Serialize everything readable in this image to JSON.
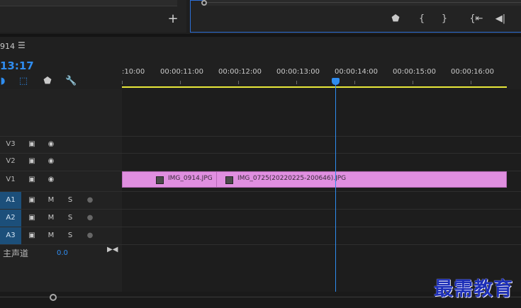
{
  "source_panel": {
    "add_icon": "plus-icon",
    "add_glyph": "+"
  },
  "program_monitor": {
    "buttons": [
      {
        "name": "add-marker-button",
        "glyph": "⬟",
        "icon": "marker-icon"
      },
      {
        "name": "mark-in-button",
        "glyph": "{",
        "icon": "mark-in-icon"
      },
      {
        "name": "mark-out-button",
        "glyph": "}",
        "icon": "mark-out-icon"
      },
      {
        "name": "go-to-in-button",
        "glyph": "{⇤",
        "icon": "go-to-in-icon"
      },
      {
        "name": "step-back-button",
        "glyph": "◀|",
        "icon": "step-back-icon"
      }
    ]
  },
  "sequence": {
    "name": "914",
    "menu_glyph": "☰",
    "timecode": "13:17"
  },
  "tools": {
    "snap_icon": "snap-icon",
    "linked_icon": "linked-selection-icon",
    "marker_icon": "add-marker-icon",
    "wrench_icon": "timeline-settings-icon",
    "glyphs": {
      "snap": "◗",
      "linked": "⬚",
      "marker": "⬟",
      "wrench": "🔧"
    }
  },
  "ruler": {
    "labels": [
      ":10:00",
      "00:00:11:00",
      "00:00:12:00",
      "00:00:13:00",
      "00:00:14:00",
      "00:00:15:00",
      "00:00:16:00"
    ],
    "playhead_time": "00:00:13:17"
  },
  "tracks": {
    "video": [
      {
        "label": "V3"
      },
      {
        "label": "V2"
      },
      {
        "label": "V1"
      }
    ],
    "audio": [
      {
        "label": "A1",
        "mute": "M",
        "solo": "S"
      },
      {
        "label": "A2",
        "mute": "M",
        "solo": "S"
      },
      {
        "label": "A3",
        "mute": "M",
        "solo": "S"
      }
    ],
    "master": {
      "label": "主声道",
      "value": "0.0"
    }
  },
  "clips": [
    {
      "name": "IMG_0914.JPG",
      "track": "V1"
    },
    {
      "name": "IMG_0725(20220225-200646).JPG",
      "track": "V1"
    }
  ],
  "colors": {
    "accent": "#2f8df0",
    "clip": "#e08fe0",
    "work_area": "#e8e83a",
    "audio_label": "#1c4f7a",
    "watermark": "#1d2fb8"
  },
  "watermark": {
    "text": "最需教育"
  }
}
